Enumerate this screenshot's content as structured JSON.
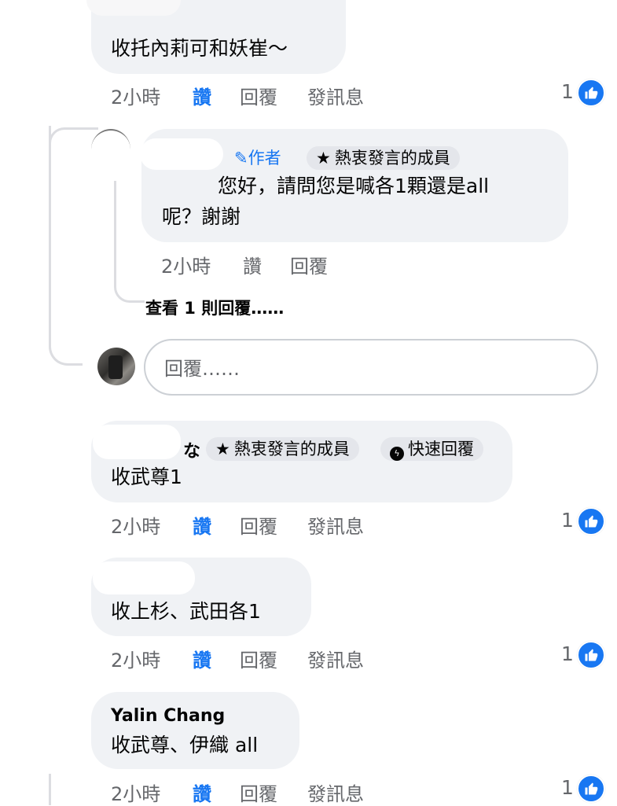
{
  "comments": [
    {
      "text": "收托內莉可和妖崔～",
      "time": "2小時",
      "like": "讚",
      "reply": "回覆",
      "message": "發訊息",
      "reactions": "1"
    },
    {
      "author_badge": "作者",
      "member_badge": "熱衷發言的成員",
      "text_line1": "您好，請問您是喊各1顆還是all",
      "text_line2": "呢？謝謝",
      "time": "2小時",
      "like": "讚",
      "reply": "回覆",
      "view_replies": "查看 1 則回覆……"
    },
    {
      "name_fragment": "な",
      "member_badge": "熱衷發言的成員",
      "quick_reply_badge": "快速回覆",
      "text": "收武尊1",
      "time": "2小時",
      "like": "讚",
      "reply": "回覆",
      "message": "發訊息",
      "reactions": "1"
    },
    {
      "text": "收上杉、武田各1",
      "time": "2小時",
      "like": "讚",
      "reply": "回覆",
      "message": "發訊息",
      "reactions": "1"
    },
    {
      "name": "Yalin Chang",
      "text": "收武尊、伊織 all",
      "time": "2小時",
      "like": "讚",
      "reply": "回覆",
      "message": "發訊息",
      "reactions": "1"
    }
  ],
  "reply_box": {
    "placeholder": "回覆……"
  },
  "colors": {
    "bubble": "#f0f2f5",
    "like_blue": "#1877f2",
    "meta_gray": "#65676b"
  },
  "icons": [
    "like-thumb-icon",
    "pencil-icon",
    "star-icon",
    "messenger-icon",
    "avatar"
  ]
}
